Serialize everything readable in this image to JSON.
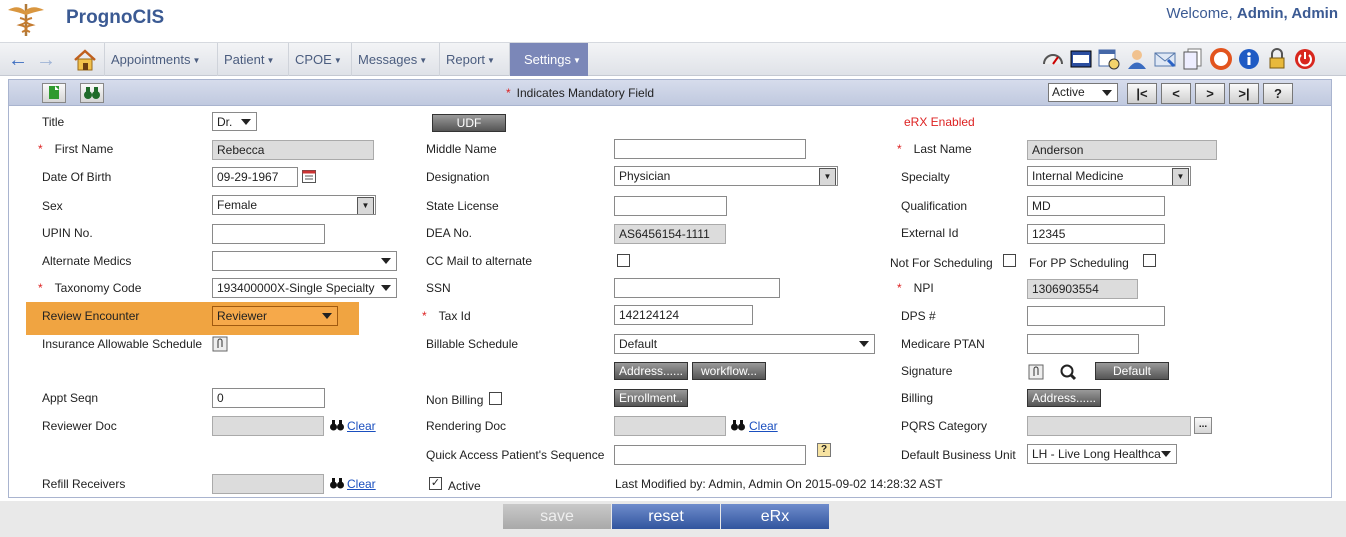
{
  "header": {
    "brand": "PrognoCIS",
    "welcome_prefix": "Welcome, ",
    "user": "Admin, Admin"
  },
  "nav": {
    "menus": [
      "Appointments",
      "Patient",
      "CPOE",
      "Messages",
      "Report",
      "Settings"
    ]
  },
  "toolbar": {
    "mandatory_note": "Indicates Mandatory Field",
    "status": "Active",
    "nav_first": "|<",
    "nav_prev": "<",
    "nav_next": ">",
    "nav_last": ">|",
    "help": "?"
  },
  "form": {
    "title_label": "Title",
    "title_value": "Dr.",
    "udf_button": "UDF",
    "erx_enabled": "eRX Enabled",
    "first_name_label": "First Name",
    "first_name": "Rebecca",
    "middle_name_label": "Middle Name",
    "middle_name": "",
    "last_name_label": "Last Name",
    "last_name": "Anderson",
    "dob_label": "Date Of Birth",
    "dob": "09-29-1967",
    "designation_label": "Designation",
    "designation": "Physician",
    "specialty_label": "Specialty",
    "specialty": "Internal Medicine",
    "sex_label": "Sex",
    "sex": "Female",
    "state_license_label": "State License",
    "state_license": "",
    "qualification_label": "Qualification",
    "qualification": "MD",
    "upin_label": "UPIN No.",
    "upin": "",
    "dea_label": "DEA No.",
    "dea": "AS6456154-1111",
    "external_id_label": "External Id",
    "external_id": "12345",
    "alt_medics_label": "Alternate Medics",
    "alt_medics": "",
    "cc_mail_label": "CC Mail to alternate",
    "not_sched_label": "Not For Scheduling",
    "pp_sched_label": "For PP Scheduling",
    "taxonomy_label": "Taxonomy Code",
    "taxonomy": "193400000X-Single Specialty",
    "ssn_label": "SSN",
    "ssn": "",
    "npi_label": "NPI",
    "npi": "1306903554",
    "review_label": "Review Encounter",
    "review": "Reviewer",
    "tax_id_label": "Tax Id",
    "tax_id": "142124124",
    "dps_label": "DPS #",
    "dps": "",
    "ins_sched_label": "Insurance Allowable Schedule",
    "billable_label": "Billable Schedule",
    "billable": "Default",
    "medicare_label": "Medicare PTAN",
    "medicare": "",
    "address_btn": "Address......",
    "workflow_btn": "workflow...",
    "signature_label": "Signature",
    "default_btn": "Default",
    "appt_seqn_label": "Appt Seqn",
    "appt_seqn": "0",
    "non_billing_label": "Non Billing",
    "enrollment_btn": "Enrollment..",
    "billing_label": "Billing",
    "billing_address_btn": "Address......",
    "reviewer_doc_label": "Reviewer Doc",
    "clear": "Clear",
    "rendering_doc_label": "Rendering Doc",
    "pqrs_label": "PQRS Category",
    "pqrs_btn": "...",
    "quick_access_label": "Quick Access Patient's Sequence",
    "quick_access": "",
    "help_q": "?",
    "business_unit_label": "Default Business Unit",
    "business_unit": "LH - Live Long Healthca",
    "refill_label": "Refill Receivers",
    "active_label": "Active",
    "last_modified": "Last Modified by: Admin, Admin On 2015-09-02 14:28:32 AST"
  },
  "bottom": {
    "save": "save",
    "reset": "reset",
    "erx": "eRx"
  }
}
